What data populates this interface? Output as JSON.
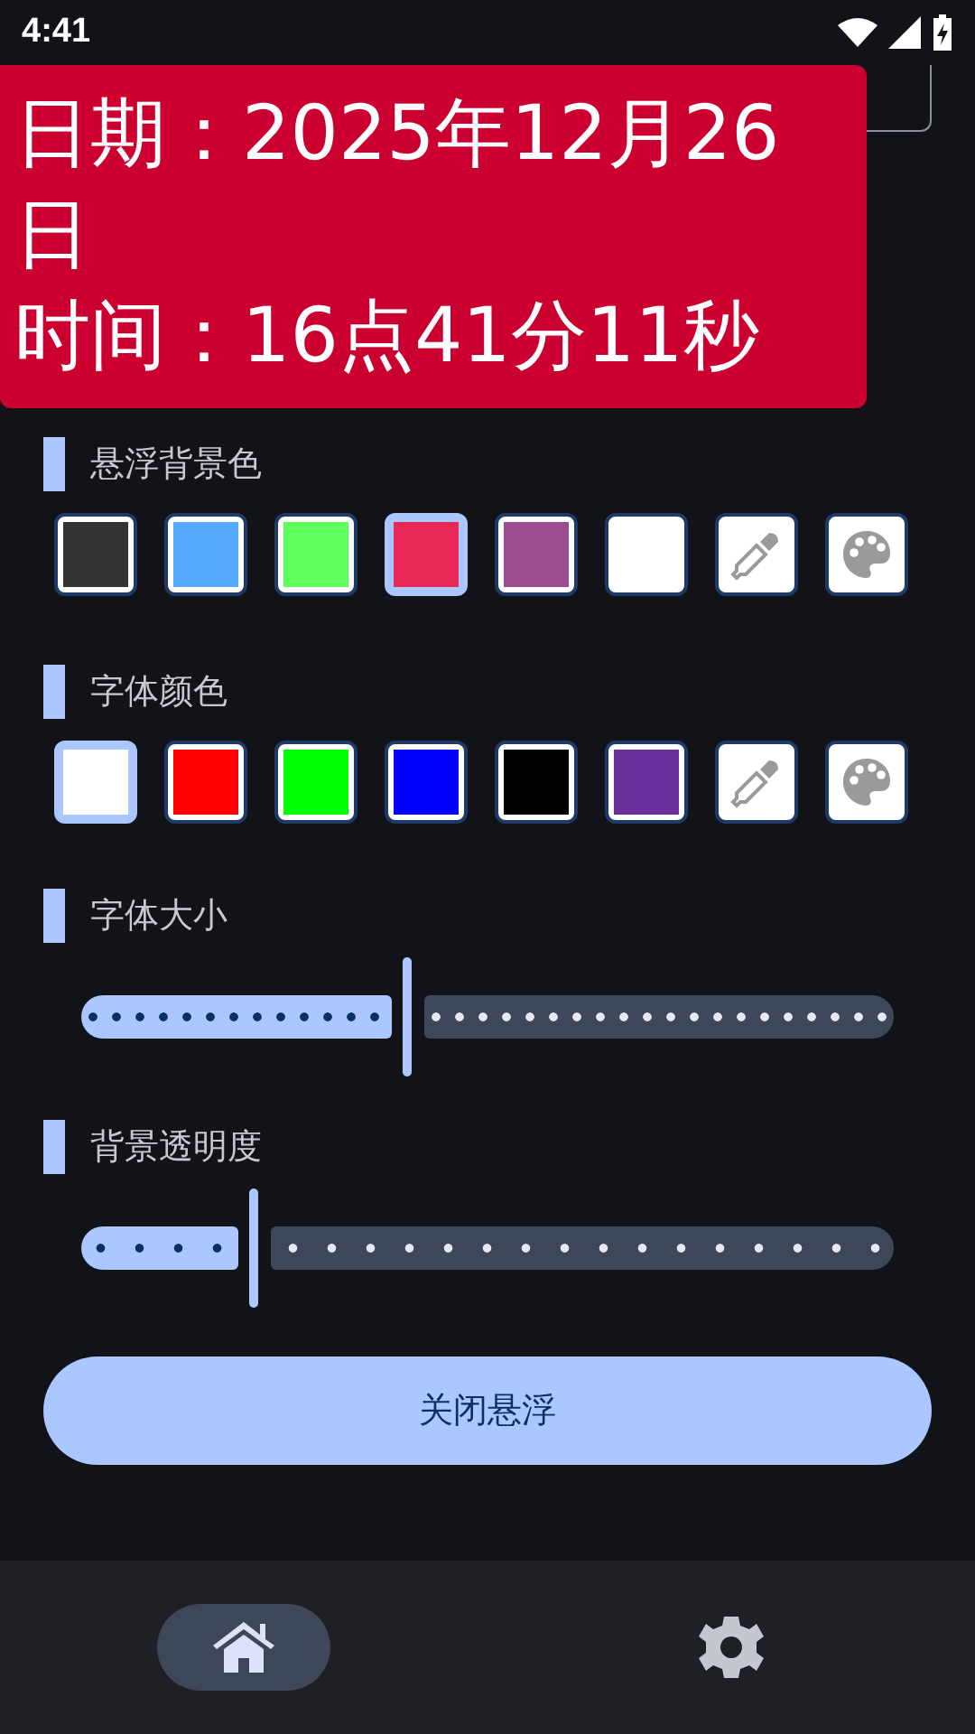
{
  "status_bar": {
    "time": "4:41"
  },
  "overlay": {
    "lines": [
      "日期：2025年12月26日",
      "时间：16点41分11秒"
    ]
  },
  "background_color": {
    "title": "悬浮背景色",
    "swatches": [
      {
        "kind": "color",
        "color": "#333333",
        "selected": false
      },
      {
        "kind": "color",
        "color": "#55aaff",
        "selected": false
      },
      {
        "kind": "color",
        "color": "#5fff5f",
        "selected": false
      },
      {
        "kind": "color",
        "color": "#ea2858",
        "selected": true
      },
      {
        "kind": "color",
        "color": "#9c4d8f",
        "selected": false
      },
      {
        "kind": "color",
        "color": "#ffffff",
        "selected": false
      },
      {
        "kind": "picker",
        "selected": false
      },
      {
        "kind": "palette",
        "selected": false
      }
    ]
  },
  "font_color": {
    "title": "字体颜色",
    "swatches": [
      {
        "kind": "color",
        "color": "#ffffff",
        "selected": true
      },
      {
        "kind": "color",
        "color": "#ff0000",
        "selected": false
      },
      {
        "kind": "color",
        "color": "#00ff00",
        "selected": false
      },
      {
        "kind": "color",
        "color": "#0000ff",
        "selected": false
      },
      {
        "kind": "color",
        "color": "#000000",
        "selected": false
      },
      {
        "kind": "color",
        "color": "#6a2f9a",
        "selected": false
      },
      {
        "kind": "picker",
        "selected": false
      },
      {
        "kind": "palette",
        "selected": false
      }
    ]
  },
  "sliders": [
    {
      "title": "字体大小",
      "level": 0.4
    },
    {
      "title": "背景透明度",
      "level": 0.21
    }
  ],
  "close_button": "关闭悬浮",
  "nav": [
    {
      "kind": "home",
      "selected": true
    },
    {
      "kind": "settings",
      "selected": false
    }
  ]
}
